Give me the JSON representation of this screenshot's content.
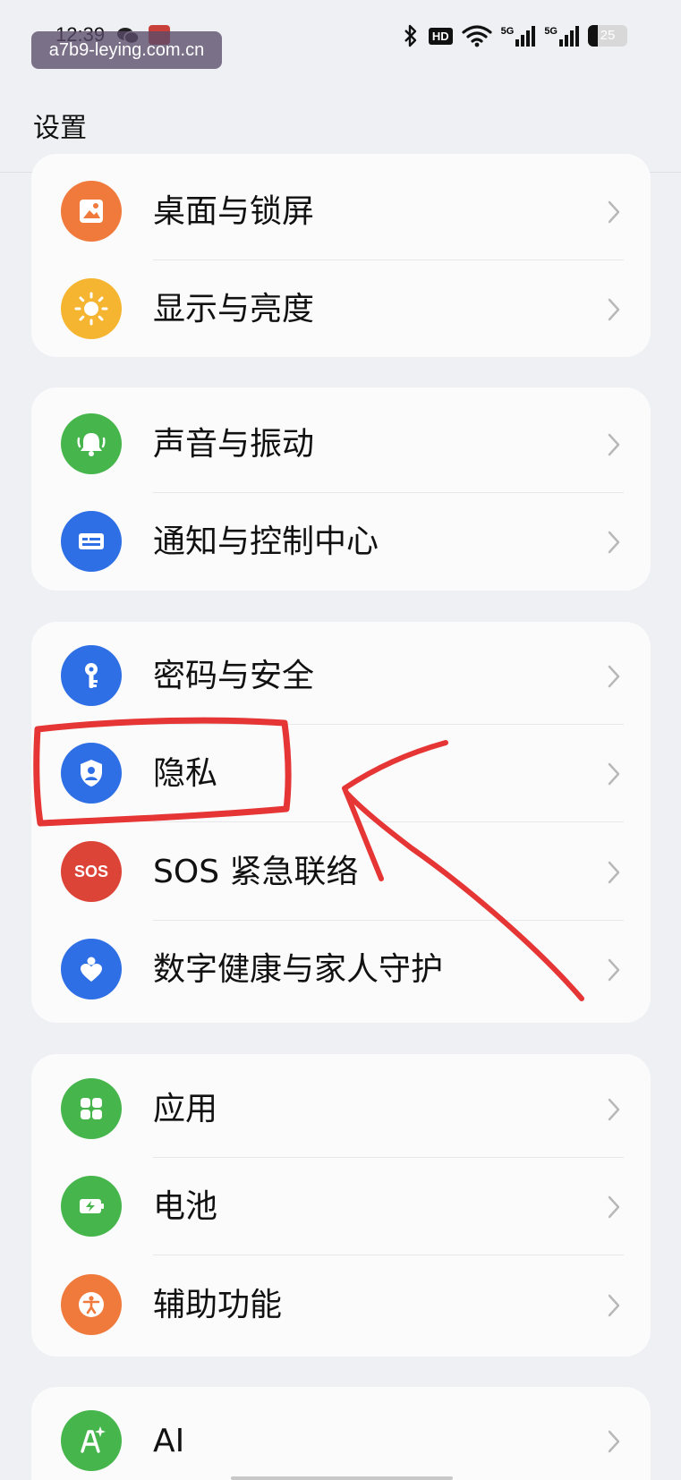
{
  "status_bar": {
    "time": "12:39",
    "watermark": "a7b9-leying.com.cn",
    "network_hd": "HD",
    "network_5g_1": "5G",
    "network_5g_2": "5G",
    "battery": "25",
    "battery_level": 0.25
  },
  "header": {
    "title": "设置"
  },
  "groups": [
    {
      "items": [
        {
          "label": "桌面与锁屏",
          "icon": "wallpaper-icon",
          "icon_color": "#f07a3c"
        },
        {
          "label": "显示与亮度",
          "icon": "sun-icon",
          "icon_color": "#f5b531"
        }
      ]
    },
    {
      "items": [
        {
          "label": "声音与振动",
          "icon": "bell-icon",
          "icon_color": "#46b64c"
        },
        {
          "label": "通知与控制中心",
          "icon": "notification-icon",
          "icon_color": "#2f6fe6"
        }
      ]
    },
    {
      "items": [
        {
          "label": "密码与安全",
          "icon": "key-icon",
          "icon_color": "#2f6fe6"
        },
        {
          "label": "隐私",
          "icon": "privacy-shield-icon",
          "icon_color": "#2f6fe6"
        },
        {
          "label": "SOS 紧急联络",
          "icon": "sos-icon",
          "icon_color": "#dd4438",
          "icon_text": "SOS"
        },
        {
          "label": "数字健康与家人守护",
          "icon": "heart-person-icon",
          "icon_color": "#2f6fe6"
        }
      ]
    },
    {
      "items": [
        {
          "label": "应用",
          "icon": "apps-grid-icon",
          "icon_color": "#46b64c"
        },
        {
          "label": "电池",
          "icon": "battery-icon",
          "icon_color": "#46b64c"
        },
        {
          "label": "辅助功能",
          "icon": "accessibility-icon",
          "icon_color": "#f07a3c"
        }
      ]
    },
    {
      "items": [
        {
          "label": "AI",
          "icon": "ai-sparkle-icon",
          "icon_color": "#46b64c"
        }
      ]
    }
  ],
  "annotation_color": "#e63535"
}
